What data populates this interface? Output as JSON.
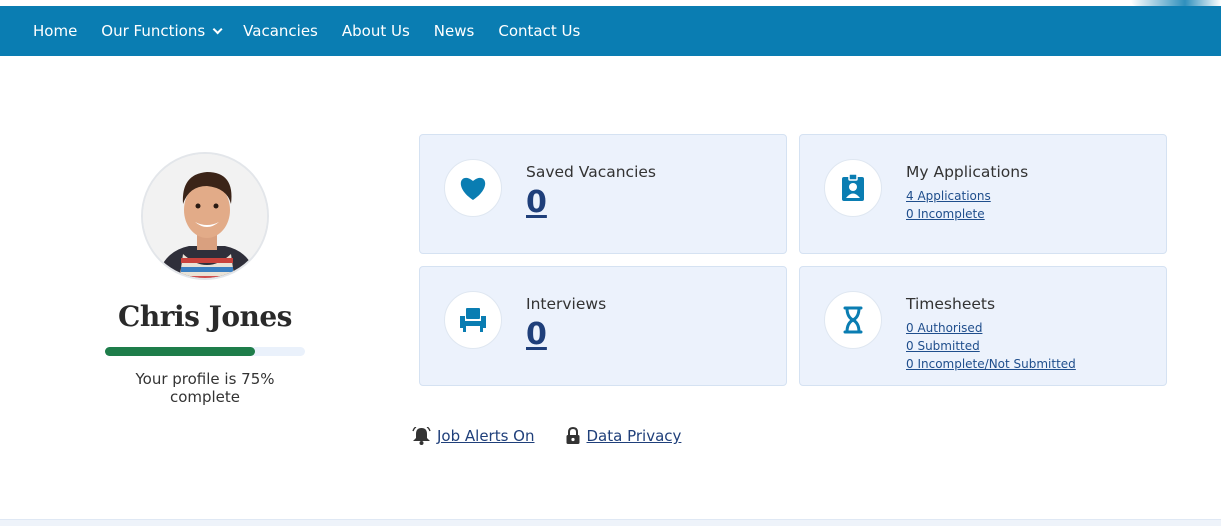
{
  "nav": {
    "items": [
      {
        "label": "Home"
      },
      {
        "label": "Our Functions",
        "has_dropdown": true
      },
      {
        "label": "Vacancies"
      },
      {
        "label": "About Us"
      },
      {
        "label": "News"
      },
      {
        "label": "Contact Us"
      }
    ]
  },
  "profile": {
    "name": "Chris Jones",
    "completion_percent": 75,
    "completion_text": "Your profile is 75% complete"
  },
  "cards": {
    "saved": {
      "title": "Saved Vacancies",
      "count": "0",
      "icon": "heart-icon"
    },
    "applications": {
      "title": "My Applications",
      "links": [
        "4 Applications",
        "0 Incomplete"
      ],
      "icon": "id-badge-icon"
    },
    "interviews": {
      "title": "Interviews",
      "count": "0",
      "icon": "chair-icon"
    },
    "timesheets": {
      "title": "Timesheets",
      "links": [
        "0 Authorised",
        "0 Submitted",
        "0 Incomplete/Not Submitted"
      ],
      "icon": "hourglass-icon"
    }
  },
  "bottom_links": {
    "job_alerts": "Job Alerts On",
    "data_privacy": "Data Privacy"
  },
  "colors": {
    "nav": "#0a7db2",
    "accent": "#0a7db2",
    "progress": "#1e7d4a",
    "card_bg": "#ecf2fc",
    "link": "#1f3f7a"
  }
}
